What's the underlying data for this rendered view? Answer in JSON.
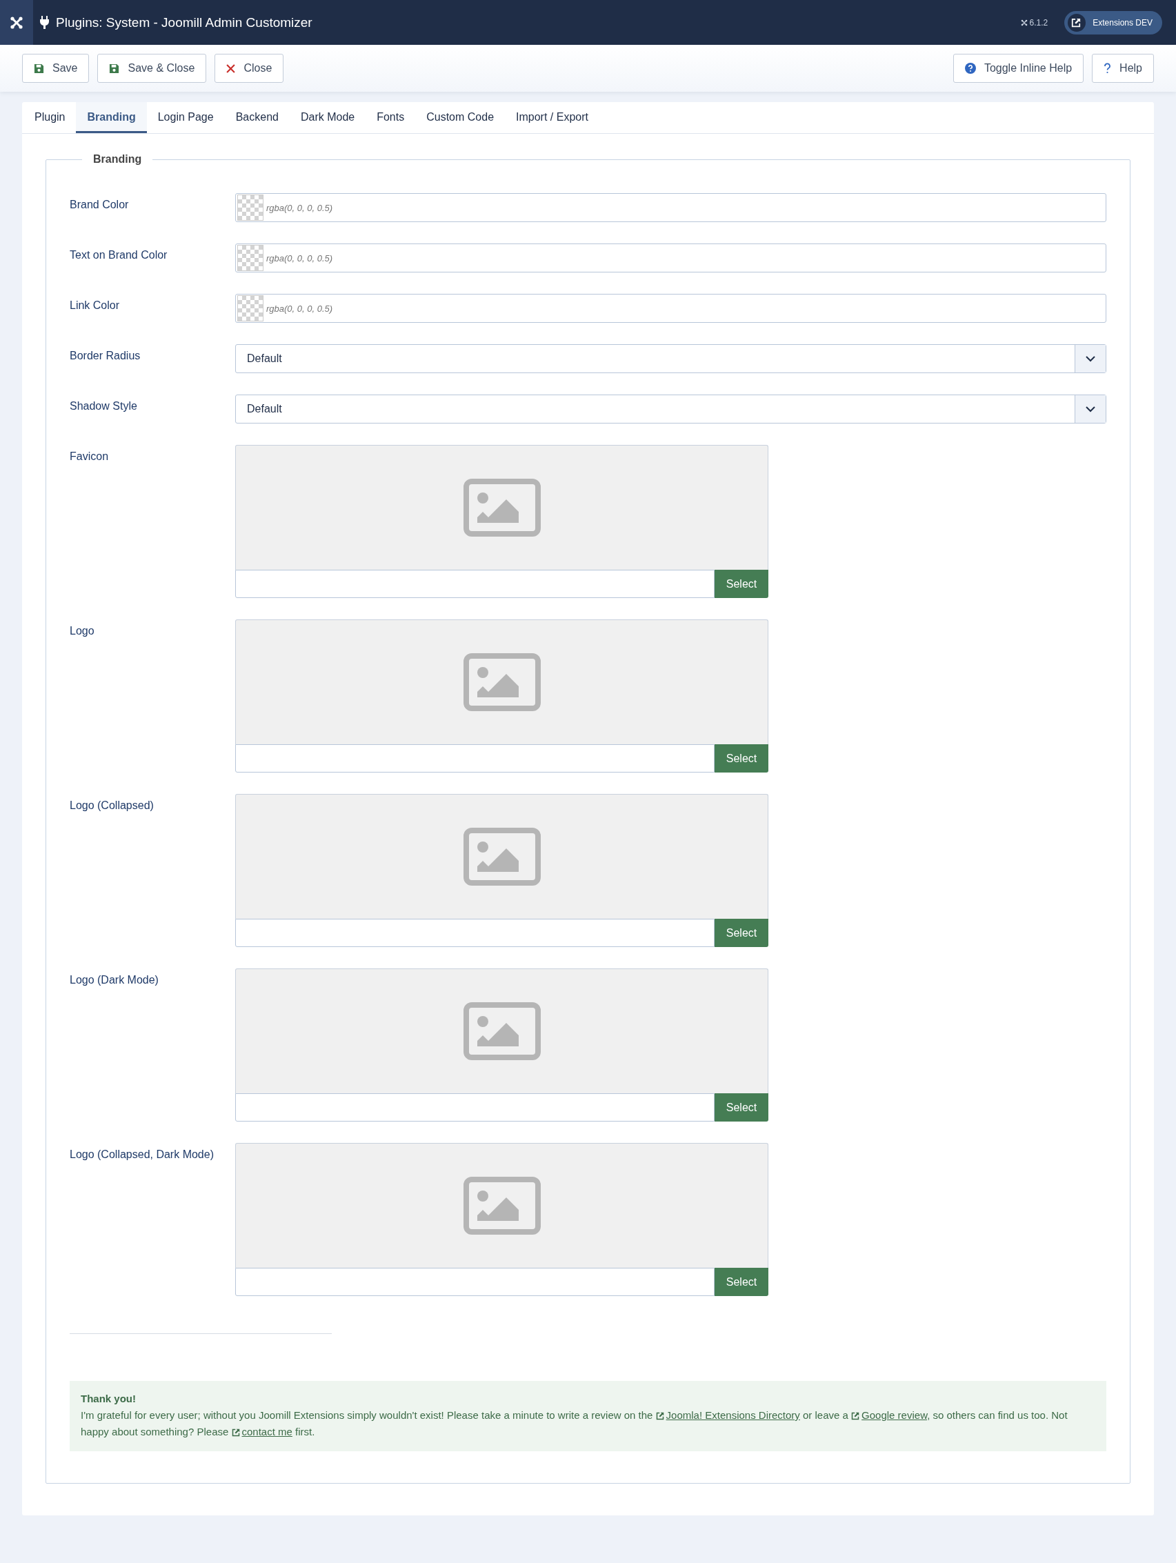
{
  "header": {
    "title": "Plugins: System - Joomill Admin Customizer",
    "version": "6.1.2",
    "user_button": "Extensions DEV"
  },
  "toolbar": {
    "left_buttons": [
      {
        "label": "Save",
        "kind": "save"
      },
      {
        "label": "Save & Close",
        "kind": "save"
      },
      {
        "label": "Close",
        "kind": "close"
      }
    ],
    "right_buttons": [
      {
        "label": "Toggle Inline Help",
        "kind": "help-circle"
      },
      {
        "label": "Help",
        "kind": "question"
      }
    ]
  },
  "tabs": [
    {
      "label": "Plugin",
      "selected": false
    },
    {
      "label": "Branding",
      "selected": true
    },
    {
      "label": "Login Page",
      "selected": false
    },
    {
      "label": "Backend",
      "selected": false
    },
    {
      "label": "Dark Mode",
      "selected": false
    },
    {
      "label": "Fonts",
      "selected": false
    },
    {
      "label": "Custom Code",
      "selected": false
    },
    {
      "label": "Import / Export",
      "selected": false
    }
  ],
  "fieldset": {
    "legend": "Branding",
    "fields": [
      {
        "label": "Brand Color",
        "kind": "color",
        "placeholder": "rgba(0, 0, 0, 0.5)"
      },
      {
        "label": "Text on Brand Color",
        "kind": "color",
        "placeholder": "rgba(0, 0, 0, 0.5)"
      },
      {
        "label": "Link Color",
        "kind": "color",
        "placeholder": "rgba(0, 0, 0, 0.5)"
      },
      {
        "label": "Border Radius",
        "kind": "select",
        "value": "Default"
      },
      {
        "label": "Shadow Style",
        "kind": "select",
        "value": "Default"
      },
      {
        "label": "Favicon",
        "kind": "media",
        "button": "Select"
      },
      {
        "label": "Logo",
        "kind": "media",
        "button": "Select"
      },
      {
        "label": "Logo (Collapsed)",
        "kind": "media",
        "button": "Select"
      },
      {
        "label": "Logo (Dark Mode)",
        "kind": "media",
        "button": "Select"
      },
      {
        "label": "Logo (Collapsed, Dark Mode)",
        "kind": "media",
        "button": "Select"
      }
    ]
  },
  "thank_you": {
    "title": "Thank you!",
    "segments": [
      {
        "kind": "text",
        "text": "I'm grateful for every user; without you Joomill Extensions simply wouldn't exist! Please take a minute to write a review on the "
      },
      {
        "kind": "link",
        "text": "Joomla! Extensions Directory"
      },
      {
        "kind": "text",
        "text": " or leave a "
      },
      {
        "kind": "link",
        "text": "Google review"
      },
      {
        "kind": "text",
        "text": ", so others can find us too. Not happy about something? Please "
      },
      {
        "kind": "link",
        "text": "contact me"
      },
      {
        "kind": "text",
        "text": " first."
      }
    ]
  }
}
